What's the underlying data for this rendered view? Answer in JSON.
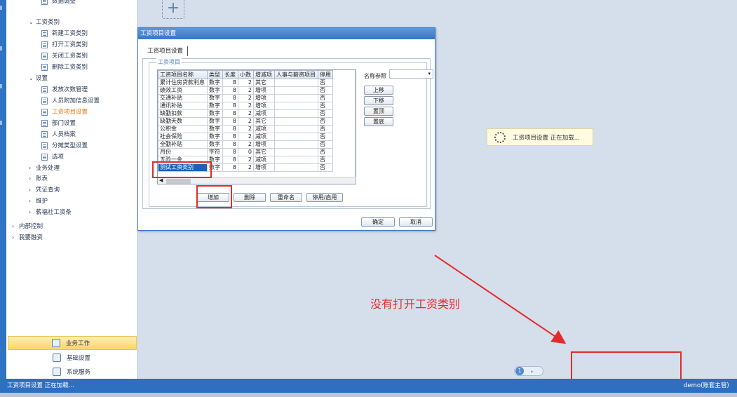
{
  "nav": {
    "items": [
      {
        "label": "数据调整",
        "level": 2,
        "type": "folder-leaf"
      },
      {
        "label": "工资类别",
        "level": 1,
        "type": "expanded"
      },
      {
        "label": "新建工资类别",
        "level": 2,
        "type": "leaf"
      },
      {
        "label": "打开工资类别",
        "level": 2,
        "type": "leaf"
      },
      {
        "label": "关闭工资类别",
        "level": 2,
        "type": "leaf"
      },
      {
        "label": "删除工资类别",
        "level": 2,
        "type": "leaf"
      },
      {
        "label": "设置",
        "level": 1,
        "type": "expanded"
      },
      {
        "label": "发放次数管理",
        "level": 2,
        "type": "leaf"
      },
      {
        "label": "人员附加信息设置",
        "level": 2,
        "type": "leaf"
      },
      {
        "label": "工资项目设置",
        "level": 2,
        "type": "leaf",
        "active": true
      },
      {
        "label": "部门设置",
        "level": 2,
        "type": "leaf"
      },
      {
        "label": "人员档案",
        "level": 2,
        "type": "leaf"
      },
      {
        "label": "分摊类型设置",
        "level": 2,
        "type": "leaf"
      },
      {
        "label": "选项",
        "level": 2,
        "type": "leaf"
      },
      {
        "label": "业务处理",
        "level": 1,
        "type": "collapsed"
      },
      {
        "label": "账表",
        "level": 1,
        "type": "collapsed"
      },
      {
        "label": "凭证查询",
        "level": 1,
        "type": "collapsed"
      },
      {
        "label": "维护",
        "level": 1,
        "type": "collapsed"
      },
      {
        "label": "薪福社工资条",
        "level": 1,
        "type": "collapsed"
      },
      {
        "label": "内部控制",
        "level": 0,
        "type": "collapsed"
      },
      {
        "label": "我要融资",
        "level": 0,
        "type": "collapsed"
      }
    ],
    "bottom_buttons": [
      {
        "label": "业务工作",
        "active": true
      },
      {
        "label": "基础设置",
        "active": false
      },
      {
        "label": "系统服务",
        "active": false
      }
    ]
  },
  "dialog": {
    "title": "工资项目设置",
    "tab": "工资项目设置",
    "group_label": "工资项目",
    "columns": [
      "工资项目名称",
      "类型",
      "长度",
      "小数",
      "增减项",
      "人事与薪资项目",
      "停用"
    ],
    "rows": [
      [
        "累计住房贷款利息",
        "数字",
        "8",
        "2",
        "其它",
        "",
        "否"
      ],
      [
        "绩效工资",
        "数字",
        "8",
        "2",
        "增项",
        "",
        "否"
      ],
      [
        "交通补贴",
        "数字",
        "8",
        "2",
        "增项",
        "",
        "否"
      ],
      [
        "通讯补贴",
        "数字",
        "8",
        "2",
        "增项",
        "",
        "否"
      ],
      [
        "缺勤扣款",
        "数字",
        "8",
        "2",
        "减项",
        "",
        "否"
      ],
      [
        "缺勤天数",
        "数字",
        "8",
        "2",
        "其它",
        "",
        "否"
      ],
      [
        "公积金",
        "数字",
        "8",
        "2",
        "减项",
        "",
        "否"
      ],
      [
        "社会保险",
        "数字",
        "8",
        "2",
        "减项",
        "",
        "否"
      ],
      [
        "全勤补贴",
        "数字",
        "8",
        "2",
        "增项",
        "",
        "否"
      ],
      [
        "月份",
        "字符",
        "8",
        "0",
        "其它",
        "",
        "否"
      ],
      [
        "五险一金",
        "数字",
        "8",
        "2",
        "减项",
        "",
        "否"
      ],
      [
        "测试工资类别",
        "数字",
        "8",
        "2",
        "增项",
        "",
        "否"
      ]
    ],
    "selected_row": 11,
    "name_ref_label": "名称参照",
    "name_ref_value": "",
    "side_buttons": [
      "上移",
      "下移",
      "置顶",
      "置底"
    ],
    "action_buttons": [
      "增加",
      "删除",
      "重命名",
      "停用/启用"
    ],
    "ok_label": "确定",
    "cancel_label": "取消"
  },
  "loading": {
    "text": "工资项目设置 正在加载..."
  },
  "pager": {
    "current": "1",
    "next": "▸"
  },
  "annotation": {
    "text": "没有打开工资类别",
    "color": "#e32b2b"
  },
  "statusbar": {
    "left": "工资项目设置 正在加载...",
    "right": "demo(账套主管)"
  },
  "workspace": {
    "add_tile_symbol": "+"
  },
  "colors": {
    "accent": "#2e6fc0",
    "active_nav": "#e07a18",
    "annotation": "#e32b2b",
    "selection": "#1f5fb7"
  }
}
